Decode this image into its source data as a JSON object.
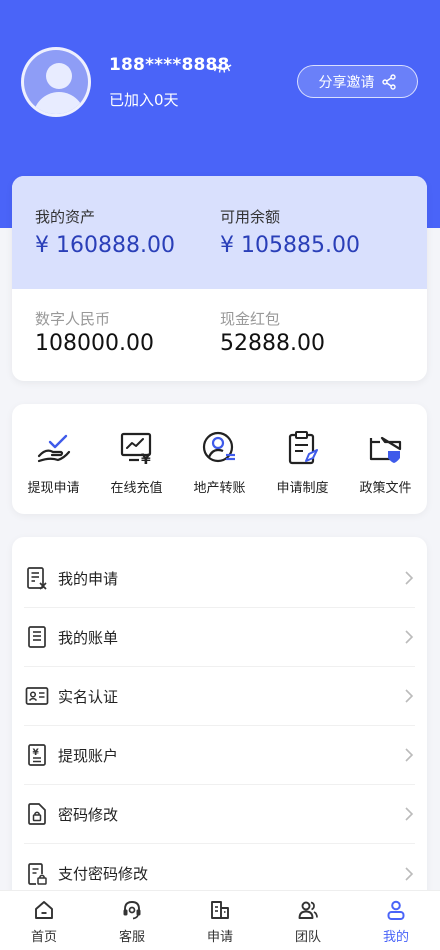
{
  "profile": {
    "phone": "188****8888",
    "joined": "已加入0天",
    "share_label": "分享邀请"
  },
  "assets": {
    "my_assets_label": "我的资产",
    "my_assets_value": "¥ 160888.00",
    "available_label": "可用余额",
    "available_value": "¥ 105885.00",
    "digital_rmb_label": "数字人民币",
    "digital_rmb_value": "108000.00",
    "cash_red_label": "现金红包",
    "cash_red_value": "52888.00"
  },
  "shortcuts": [
    {
      "label": "提现申请",
      "icon": "withdraw-hand-icon"
    },
    {
      "label": "在线充值",
      "icon": "recharge-chart-icon"
    },
    {
      "label": "地产转账",
      "icon": "property-transfer-icon"
    },
    {
      "label": "申请制度",
      "icon": "clipboard-icon"
    },
    {
      "label": "政策文件",
      "icon": "folder-shield-icon"
    }
  ],
  "menu": [
    {
      "label": "我的申请",
      "icon": "application-doc-icon"
    },
    {
      "label": "我的账单",
      "icon": "bill-icon"
    },
    {
      "label": "实名认证",
      "icon": "id-card-icon"
    },
    {
      "label": "提现账户",
      "icon": "yuan-doc-icon"
    },
    {
      "label": "密码修改",
      "icon": "lock-doc-icon"
    },
    {
      "label": "支付密码修改",
      "icon": "pay-lock-doc-icon"
    }
  ],
  "tabs": [
    {
      "label": "首页",
      "icon": "home-icon"
    },
    {
      "label": "客服",
      "icon": "headset-icon"
    },
    {
      "label": "申请",
      "icon": "apply-icon"
    },
    {
      "label": "团队",
      "icon": "team-icon"
    },
    {
      "label": "我的",
      "icon": "user-icon",
      "active": true
    }
  ],
  "colors": {
    "primary": "#4a64f8",
    "asset_panel": "#d9e0fd",
    "asset_value": "#2a3fb8",
    "shortcut_accent": "#3f5bea"
  }
}
